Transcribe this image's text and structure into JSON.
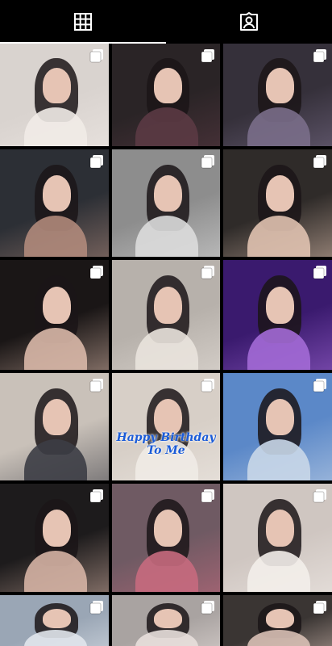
{
  "tabs": [
    {
      "name": "grid",
      "icon": "grid-icon",
      "active": true
    },
    {
      "name": "tagged",
      "icon": "tagged-person-icon",
      "active": false
    }
  ],
  "posts": [
    {
      "bg": "#d9d3cf",
      "accent": "#f1ebe7",
      "multi": true
    },
    {
      "bg": "#2a2426",
      "accent": "#5b3a44",
      "multi": true
    },
    {
      "bg": "#35303a",
      "accent": "#7a6e8a",
      "multi": true
    },
    {
      "bg": "#2c2f35",
      "accent": "#b08a7b",
      "multi": true
    },
    {
      "bg": "#8d8d8d",
      "accent": "#dcdcdc",
      "multi": true
    },
    {
      "bg": "#2f2b29",
      "accent": "#e0c2b0",
      "multi": true
    },
    {
      "bg": "#1a1616",
      "accent": "#d9b8a8",
      "multi": true
    },
    {
      "bg": "#b7b1ab",
      "accent": "#e9e3dd",
      "multi": true
    },
    {
      "bg": "#3a1a6e",
      "accent": "#a36ad6",
      "multi": true
    },
    {
      "bg": "#c9c1b9",
      "accent": "#3c3d45",
      "multi": true
    },
    {
      "bg": "#d7cfc7",
      "accent": "#f0ebe6",
      "multi": true,
      "caption": "Happy Birthday\nTo Me"
    },
    {
      "bg": "#5b88c8",
      "accent": "#c9d7e8",
      "multi": true
    },
    {
      "bg": "#1d1b1c",
      "accent": "#d5b3a4",
      "multi": true
    },
    {
      "bg": "#6f5a63",
      "accent": "#c66a7e",
      "multi": true
    },
    {
      "bg": "#cfc6c1",
      "accent": "#f3eeea",
      "multi": true
    },
    {
      "bg": "#9aa6b5",
      "accent": "#e1e6ec",
      "multi": true
    },
    {
      "bg": "#a9a3a1",
      "accent": "#e8dfdc",
      "multi": true
    },
    {
      "bg": "#3a3533",
      "accent": "#d8c0b5",
      "multi": true
    }
  ]
}
